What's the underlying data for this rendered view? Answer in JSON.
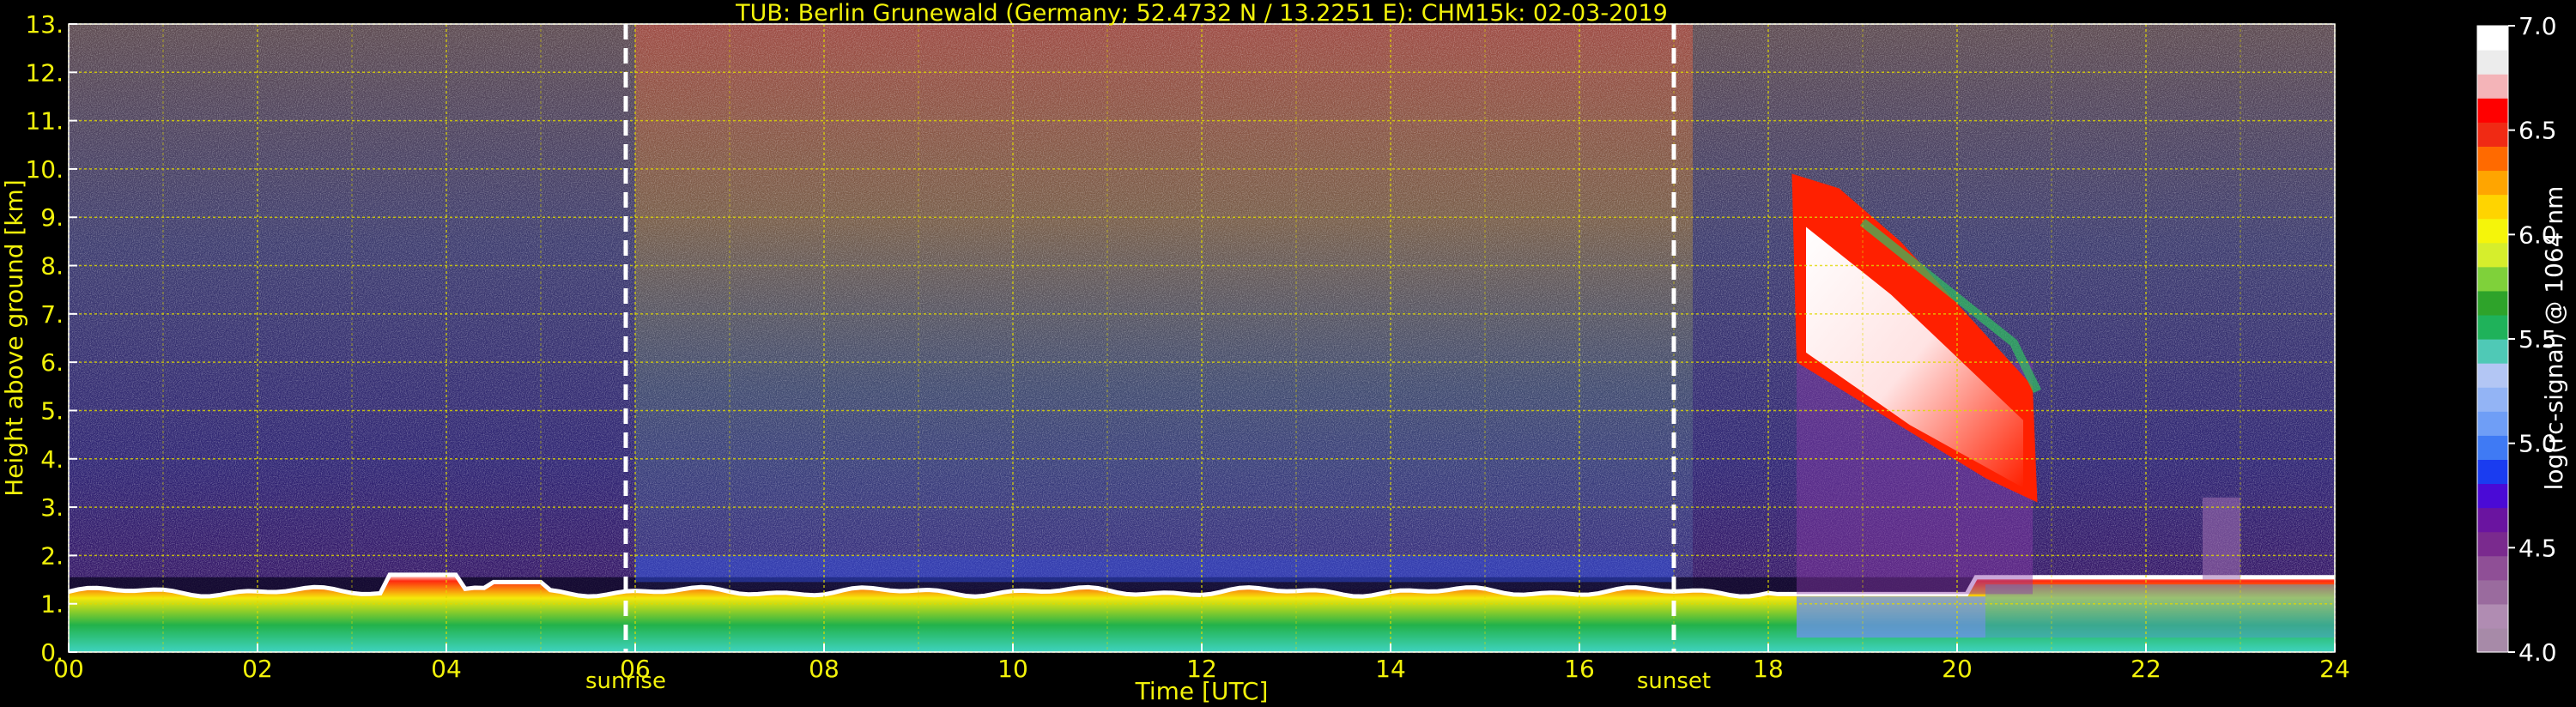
{
  "chart_data": {
    "type": "heatmap",
    "title": "TUB: Berlin Grunewald (Germany; 52.4732 N / 13.2251 E):    CHM15k: 02-03-2019",
    "xlabel": "Time [UTC]",
    "ylabel": "Height above ground [km]",
    "x_ticks": [
      "00",
      "02",
      "04",
      "06",
      "08",
      "10",
      "12",
      "14",
      "16",
      "18",
      "20",
      "22",
      "24"
    ],
    "y_ticks": [
      "0.",
      "1.",
      "2.",
      "3.",
      "4.",
      "5.",
      "6.",
      "7.",
      "8.",
      "9.",
      "10.",
      "11.",
      "12.",
      "13."
    ],
    "xlim": [
      0,
      24
    ],
    "ylim": [
      0,
      13
    ],
    "grid": true,
    "markers": [
      {
        "label": "sunrise",
        "x": 5.9
      },
      {
        "label": "sunset",
        "x": 17.0
      }
    ],
    "colorbar": {
      "label": "log(rc-signal) @ 1064 nm",
      "ticks": [
        "4.0",
        "4.5",
        "5.0",
        "5.5",
        "6.0",
        "6.5",
        "7.0"
      ],
      "range": [
        4.0,
        7.0
      ],
      "colors": [
        "#a78aa8",
        "#b08cb2",
        "#9a6b9e",
        "#8f4f96",
        "#7a2a8e",
        "#6a14a0",
        "#4a0ad6",
        "#1a3cf0",
        "#3f7af4",
        "#6f9ef6",
        "#93b4f5",
        "#b3c6f4",
        "#4fc9b6",
        "#1fb25a",
        "#2ea32a",
        "#7fd13a",
        "#d6ee2c",
        "#f5f50a",
        "#ffd400",
        "#ffa500",
        "#ff6a00",
        "#f02a14",
        "#ff0000",
        "#f4b4b8",
        "#ececec",
        "#ffffff"
      ]
    },
    "colors": {
      "axis_text": "#f2f20a",
      "grid": "#e0d900",
      "background": "#000000"
    }
  }
}
